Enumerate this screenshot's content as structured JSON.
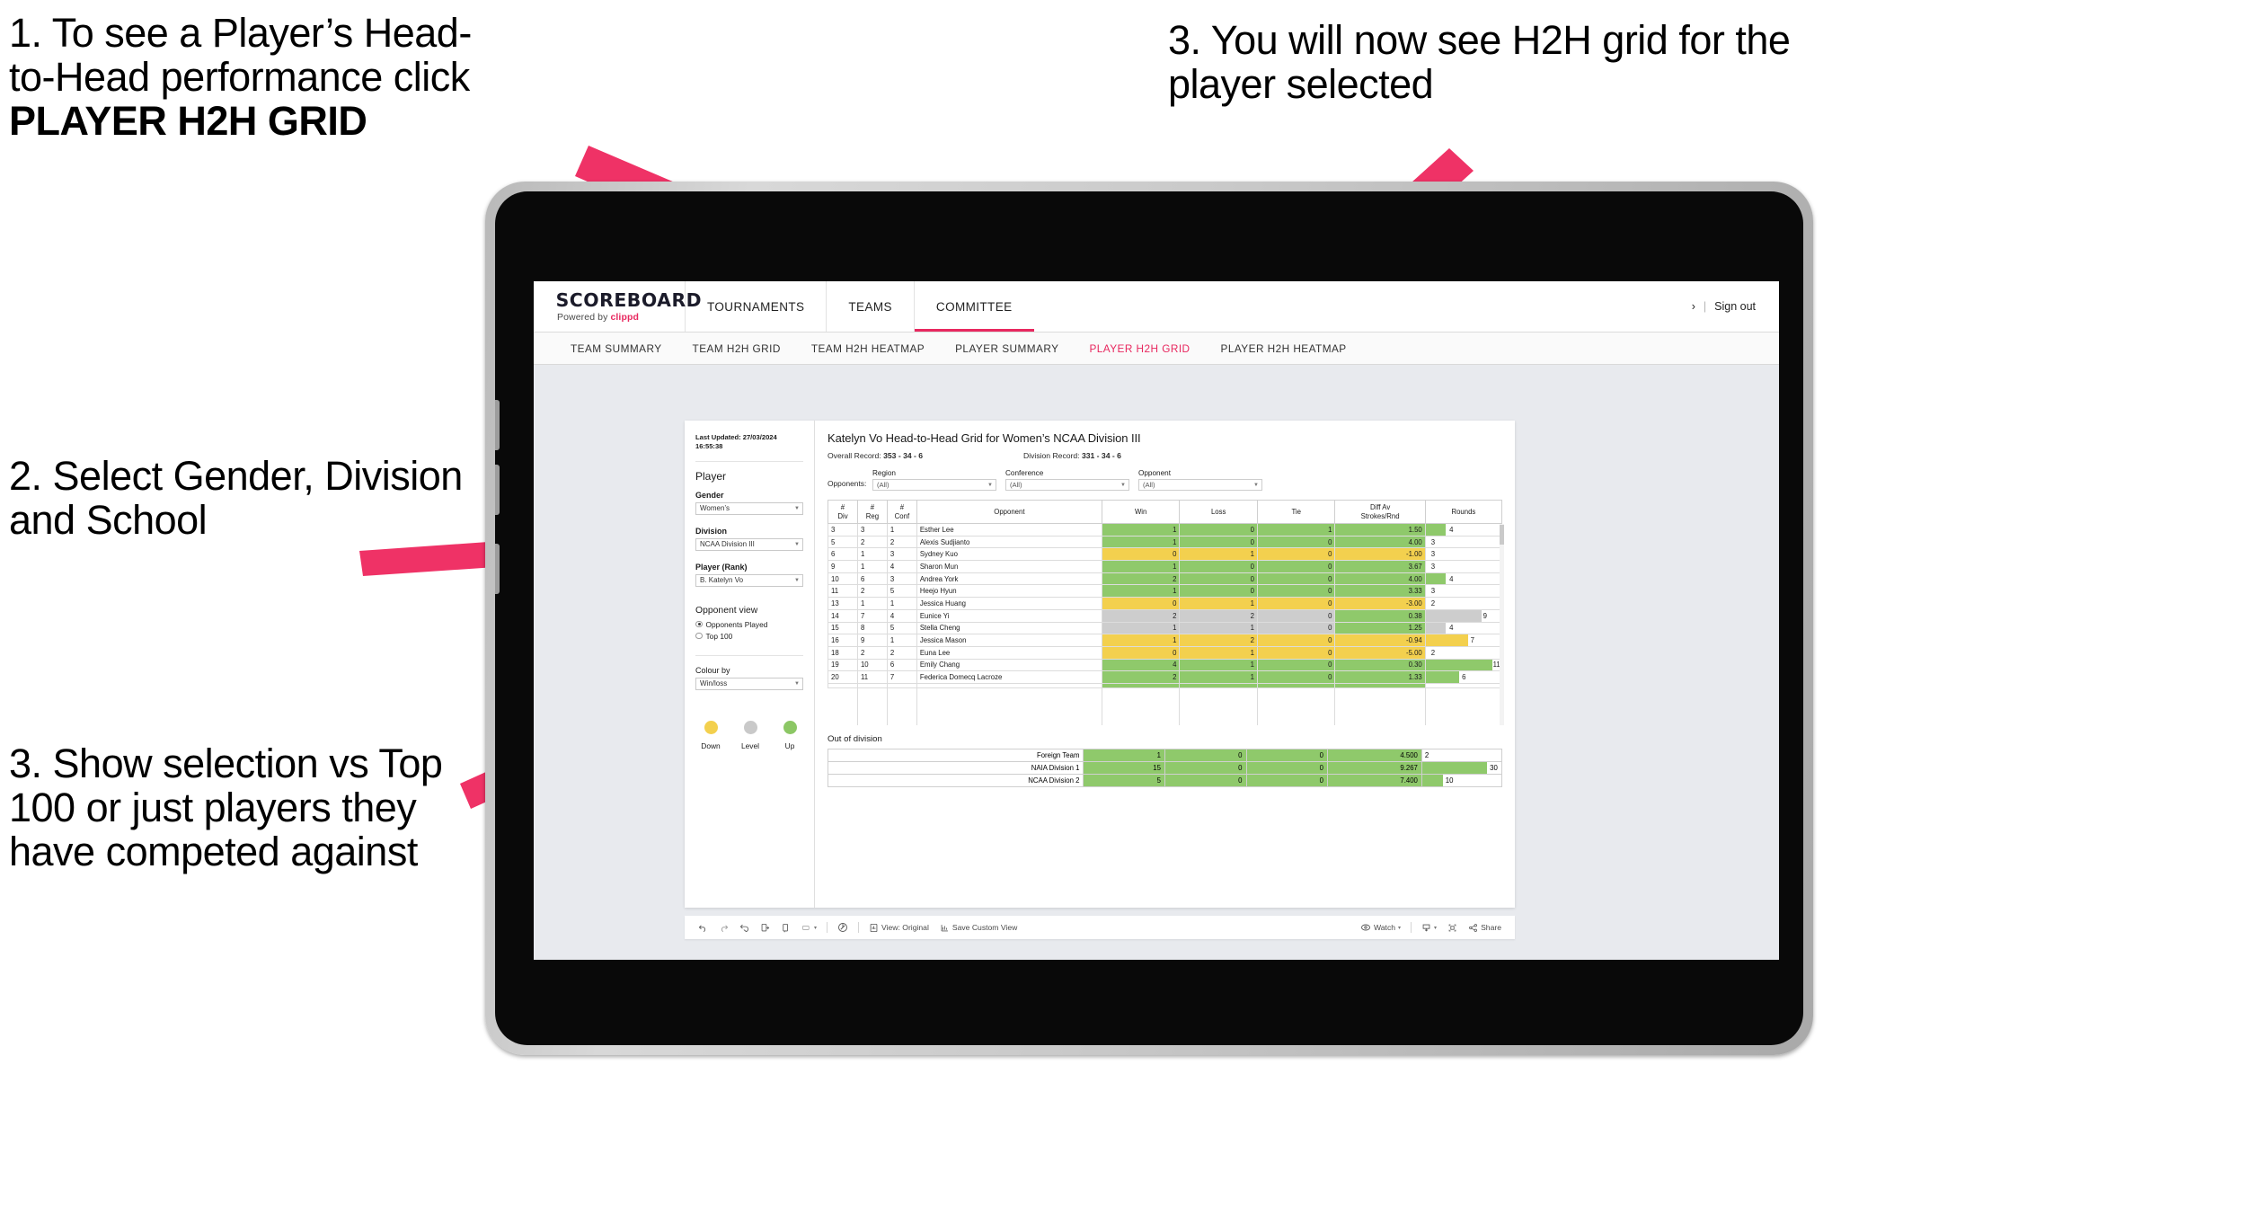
{
  "annotations": [
    {
      "id": "annot-1",
      "lines": [
        "1. To see a Player’s Head-",
        "to-Head performance click"
      ],
      "bold_line": "PLAYER H2H GRID"
    },
    {
      "id": "annot-2",
      "text": "2. Select Gender, Division and School"
    },
    {
      "id": "annot-3",
      "text": "3. Show selection vs Top 100 or just players they have competed against"
    },
    {
      "id": "annot-4",
      "text": "3. You will now see H2H grid for the player selected"
    }
  ],
  "annotation_text": {
    "a1_l1": "1. To see a Player’s Head-",
    "a1_l2": "to-Head performance click",
    "a1_bold": "PLAYER H2H GRID",
    "a2": "2. Select Gender, Division and School",
    "a3": "3. Show selection vs Top 100 or just players they have competed against",
    "a4": "3. You will now see H2H grid for the player selected"
  },
  "colors": {
    "accent_pink": "#e8285f",
    "arrow_pink": "#ef3266",
    "green": "#8fc96b",
    "yellow": "#f3d04e",
    "grey": "#cdcdcd"
  },
  "app": {
    "logo": {
      "main": "SCOREBOARD",
      "sub_prefix": "Powered by ",
      "sub_brand": "clippd"
    },
    "topnav": [
      {
        "label": "TOURNAMENTS",
        "active": false
      },
      {
        "label": "TEAMS",
        "active": false
      },
      {
        "label": "COMMITTEE",
        "active": true
      }
    ],
    "account": {
      "chevron": "›",
      "divider": "|",
      "signout": "Sign out"
    },
    "subnav": [
      {
        "label": "TEAM SUMMARY",
        "active": false
      },
      {
        "label": "TEAM H2H GRID",
        "active": false
      },
      {
        "label": "TEAM H2H HEATMAP",
        "active": false
      },
      {
        "label": "PLAYER SUMMARY",
        "active": false
      },
      {
        "label": "PLAYER H2H GRID",
        "active": true
      },
      {
        "label": "PLAYER H2H HEATMAP",
        "active": false
      }
    ]
  },
  "filters": {
    "last_updated": "Last Updated: 27/03/2024 16:55:38",
    "player_heading": "Player",
    "gender": {
      "label": "Gender",
      "value": "Women’s"
    },
    "division": {
      "label": "Division",
      "value": "NCAA Division III"
    },
    "player_rank": {
      "label": "Player (Rank)",
      "value": "B. Katelyn Vo"
    },
    "opponent_view": {
      "heading": "Opponent view",
      "options": [
        {
          "label": "Opponents Played",
          "selected": true
        },
        {
          "label": "Top 100",
          "selected": false
        }
      ]
    },
    "colour_by": {
      "label": "Colour by",
      "value": "Win/loss"
    },
    "legend": [
      {
        "label": "Down",
        "color": "#f3d04e"
      },
      {
        "label": "Level",
        "color": "#c9c9c9"
      },
      {
        "label": "Up",
        "color": "#8cc765"
      }
    ]
  },
  "content": {
    "title": "Katelyn Vo Head-to-Head Grid for Women’s NCAA Division III",
    "overall_record_label": "Overall Record: ",
    "overall_record_value": "353 - 34 - 6",
    "division_record_label": "Division Record: ",
    "division_record_value": "331 - 34 - 6",
    "opponents_label": "Opponents:",
    "opponent_filters": [
      {
        "label": "Region",
        "value": "(All)"
      },
      {
        "label": "Conference",
        "value": "(All)"
      },
      {
        "label": "Opponent",
        "value": "(All)"
      }
    ],
    "columns": [
      "# Div",
      "# Reg",
      "# Conf",
      "Opponent",
      "Win",
      "Loss",
      "Tie",
      "Diff Av Strokes/Rnd",
      "Rounds"
    ],
    "columns_split": [
      {
        "l1": "#",
        "l2": "Div"
      },
      {
        "l1": "#",
        "l2": "Reg"
      },
      {
        "l1": "#",
        "l2": "Conf"
      },
      {
        "l1": "Opponent",
        "l2": ""
      },
      {
        "l1": "Win",
        "l2": ""
      },
      {
        "l1": "Loss",
        "l2": ""
      },
      {
        "l1": "Tie",
        "l2": ""
      },
      {
        "l1": "Diff Av",
        "l2": "Strokes/Rnd"
      },
      {
        "l1": "Rounds",
        "l2": ""
      }
    ],
    "rows": [
      {
        "div": "3",
        "reg": "3",
        "conf": "1",
        "opponent": "Esther Lee",
        "win": "1",
        "loss": "0",
        "tie": "1",
        "diff": "1.50",
        "rounds": "4",
        "fill": "green",
        "bar_pct": 26
      },
      {
        "div": "5",
        "reg": "2",
        "conf": "2",
        "opponent": "Alexis Sudjianto",
        "win": "1",
        "loss": "0",
        "tie": "0",
        "diff": "4.00",
        "rounds": "3",
        "fill": "green",
        "bar_pct": 0
      },
      {
        "div": "6",
        "reg": "1",
        "conf": "3",
        "opponent": "Sydney Kuo",
        "win": "0",
        "loss": "1",
        "tie": "0",
        "diff": "-1.00",
        "rounds": "3",
        "fill": "yellow",
        "bar_pct": 0
      },
      {
        "div": "9",
        "reg": "1",
        "conf": "4",
        "opponent": "Sharon Mun",
        "win": "1",
        "loss": "0",
        "tie": "0",
        "diff": "3.67",
        "rounds": "3",
        "fill": "green",
        "bar_pct": 0
      },
      {
        "div": "10",
        "reg": "6",
        "conf": "3",
        "opponent": "Andrea York",
        "win": "2",
        "loss": "0",
        "tie": "0",
        "diff": "4.00",
        "rounds": "4",
        "fill": "green",
        "bar_pct": 26
      },
      {
        "div": "11",
        "reg": "2",
        "conf": "5",
        "opponent": "Heejo Hyun",
        "win": "1",
        "loss": "0",
        "tie": "0",
        "diff": "3.33",
        "rounds": "3",
        "fill": "green",
        "bar_pct": 0
      },
      {
        "div": "13",
        "reg": "1",
        "conf": "1",
        "opponent": "Jessica Huang",
        "win": "0",
        "loss": "1",
        "tie": "0",
        "diff": "-3.00",
        "rounds": "2",
        "fill": "yellow",
        "bar_pct": 0
      },
      {
        "div": "14",
        "reg": "7",
        "conf": "4",
        "opponent": "Eunice Yi",
        "win": "2",
        "loss": "2",
        "tie": "0",
        "diff": "0.38",
        "rounds": "9",
        "fill": "grey",
        "bar_pct": 74,
        "diff_fill": "green"
      },
      {
        "div": "15",
        "reg": "8",
        "conf": "5",
        "opponent": "Stella Cheng",
        "win": "1",
        "loss": "1",
        "tie": "0",
        "diff": "1.25",
        "rounds": "4",
        "fill": "grey",
        "bar_pct": 26,
        "diff_fill": "green"
      },
      {
        "div": "16",
        "reg": "9",
        "conf": "1",
        "opponent": "Jessica Mason",
        "win": "1",
        "loss": "2",
        "tie": "0",
        "diff": "-0.94",
        "rounds": "7",
        "fill": "yellow",
        "bar_pct": 56
      },
      {
        "div": "18",
        "reg": "2",
        "conf": "2",
        "opponent": "Euna Lee",
        "win": "0",
        "loss": "1",
        "tie": "0",
        "diff": "-5.00",
        "rounds": "2",
        "fill": "yellow",
        "bar_pct": 0
      },
      {
        "div": "19",
        "reg": "10",
        "conf": "6",
        "opponent": "Emily Chang",
        "win": "4",
        "loss": "1",
        "tie": "0",
        "diff": "0.30",
        "rounds": "11",
        "fill": "green",
        "bar_pct": 88
      },
      {
        "div": "20",
        "reg": "11",
        "conf": "7",
        "opponent": "Federica Domecq Lacroze",
        "win": "2",
        "loss": "1",
        "tie": "0",
        "diff": "1.33",
        "rounds": "6",
        "fill": "green",
        "bar_pct": 44
      }
    ],
    "out_of_division": {
      "title": "Out of division",
      "rows": [
        {
          "name": "Foreign Team",
          "win": "1",
          "loss": "0",
          "tie": "0",
          "diff": "4.500",
          "rounds": "2",
          "fill": "green",
          "bar_pct": 0
        },
        {
          "name": "NAIA Division 1",
          "win": "15",
          "loss": "0",
          "tie": "0",
          "diff": "9.267",
          "rounds": "30",
          "fill": "green",
          "bar_pct": 82
        },
        {
          "name": "NCAA Division 2",
          "win": "5",
          "loss": "0",
          "tie": "0",
          "diff": "7.400",
          "rounds": "10",
          "fill": "green",
          "bar_pct": 26
        }
      ]
    }
  },
  "toolbar": {
    "view_label": "View: Original",
    "save_label": "Save Custom View",
    "watch_label": "Watch",
    "share_label": "Share",
    "caret": "▾"
  }
}
